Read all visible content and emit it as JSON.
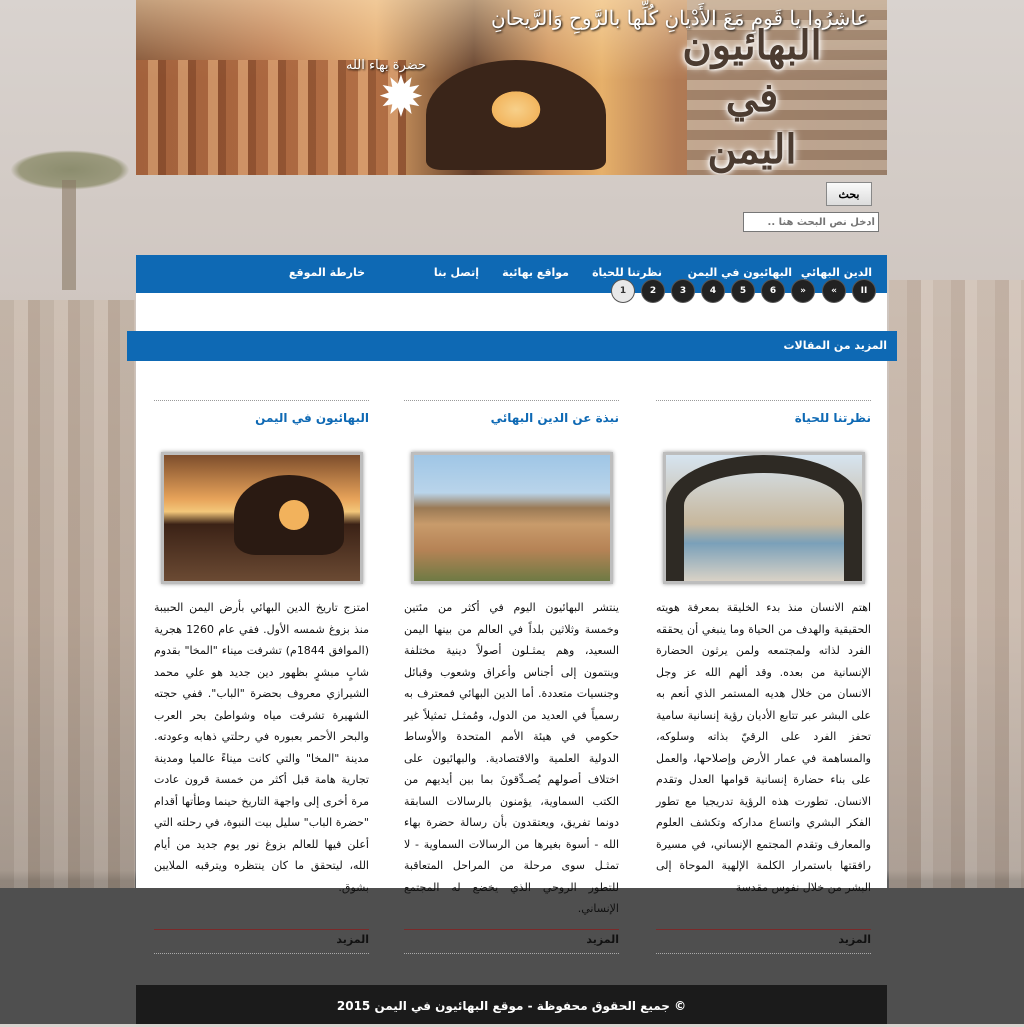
{
  "header": {
    "logo_line1": "البهائيون",
    "logo_line2": "في اليمن",
    "quote": "عاشِرُوا يا قَومِ مَعَ الأَدْيانِ كُلِّها بالرَّوحِ وَالرَّيحانِ",
    "quote_source": "حضرة بهاء الله",
    "emblem": "nine-pointed-star"
  },
  "search": {
    "button_label": "بحث",
    "placeholder": "أدخل نص البحث هنا .."
  },
  "nav": {
    "items": [
      {
        "label": "الدين البهائي"
      },
      {
        "label": "البهائيون في اليمن"
      },
      {
        "label": "نظرتنا للحياة"
      },
      {
        "label": "مواقع بهائية"
      },
      {
        "label": "إتصل بنا"
      },
      {
        "label": "خارطة الموقع"
      }
    ]
  },
  "slider": {
    "controls": [
      "II",
      "«",
      "»",
      "6",
      "5",
      "4",
      "3",
      "2",
      "1"
    ],
    "active": "1"
  },
  "section": {
    "title": "المزيد من المقالات"
  },
  "articles": [
    {
      "title": "نظرتنا للحياة",
      "image": "arched-window-view",
      "body": "اهتم الانسان منذ بدء الخليقة بمعرفة هويته الحقيقية والهدف من الحياة وما ينبغي أن يحققه الفرد لذاته ولمجتمعه ولمن يرثون الحضارة الإنسانية من بعده. وقد ألهم الله عز وجل الانسان من خلال هديه المستمر الذي أنعم به على البشر عبر تتابع الأديان رؤية إنسانية سامية تحفز الفرد على الرقيّ بذاته وسلوكه، والمساهمة في عمار الأرض وإصلاحها، والعمل على بناء حضارة إنسانية قوامها العدل وتقدم الانسان. تطورت هذه الرؤية تدريجيا مع تطور الفكر البشري واتساع مداركه وتكشف العلوم والمعارف وتقدم المجتمع الإنساني، في مسيرة رافقتها باستمرار الكلمة الإلهية الموحاة إلى البشر من خلال نفوس مقدسة",
      "more": "المزيد"
    },
    {
      "title": "نبذة عن الدين البهائي",
      "image": "shibam-town",
      "body": "ينتشر البهائيون اليوم في أكثر من مئتين وخمسة وثلاثين بلداً في العالم من بينها اليمن السعيد، وهم يمثـلون أصولاً دينية مختلفة وينتمون إلى أجناس وأعراق وشعوب وقبائل وجنسيات متعددة. أما الدين البهائي فمعترف به رسمياً في العديد من الدول، ومُمثـل تمثيلاً غير حكومي في هيئة الأمم المتحدة والأوساط الدولية العلمية والاقتصادية. والبهائيون على اختلاف أصولهم يُصـدِّقونَ بما بين أيديهم من الكتب السماوية، يؤمنون بالرسالات السابقة دونما تفريق، ويعتقدون بأن رسالة حضرة بهاء الله - أسوة بغيرها من الرسالات السماوية - لا تمثـل سوى مرحلة من المراحل المتعاقبة للتطور الروحي الذي يخضع له المجتمع الإنساني.",
      "more": "المزيد"
    },
    {
      "title": "البهائيون في اليمن",
      "image": "rock-arch-sunset",
      "body": "امتزج تاريخ الدين البهائي بأرض اليمن الحبيبة منذ بزوغ شمسه الأول. ففي عام 1260 هجرية (الموافق 1844م) تشرفت ميناء \"المخا\" بقدوم شابٍ مبشرٍ بظهور دين جديد هو علي محمد الشيرازي معروف بحضرة \"الباب\". ففي حجته الشهيرة تشرفت مياه وشواطئ بحر العرب والبحر الأحمر بعبوره في رحلتي ذهابه وعودته. مدينة \"المخا\" والتي كانت ميناءً عالميا ومدينة تجارية هامة قبل أكثر من خمسة قرون عادت مرة أخرى إلى واجهة التاريخ حينما وطأتها أقدام \"حضرة الباب\" سليل بيت النبوة، في رحلته التي أعلن فيها للعالم بزوغ نور يوم جديد من أيام الله، ليتحقق ما كان ينتظره ويترقبه الملايين بشوق.",
      "more": "المزيد"
    }
  ],
  "footer": {
    "text": "© جميع الحقوق محفوظة - موقع البهائيون في اليمن 2015"
  },
  "colors": {
    "accent": "#0e69b4",
    "footer_bg": "#1b1b1b"
  }
}
